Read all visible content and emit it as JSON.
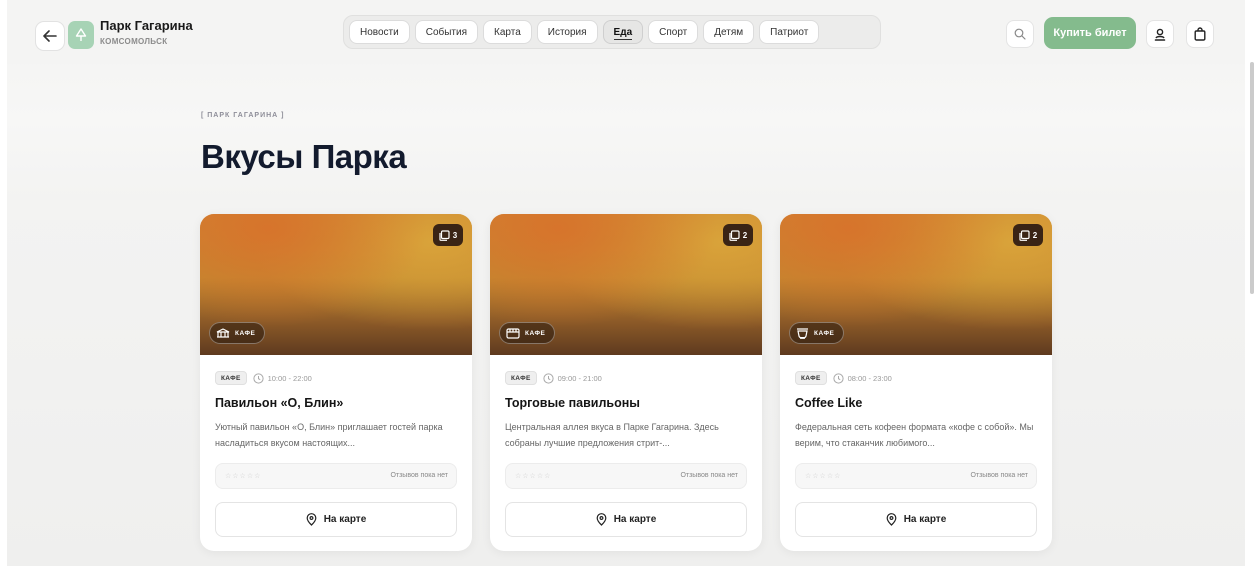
{
  "header": {
    "brand_title": "Парк Гагарина",
    "brand_subtitle": "КОМСОМОЛЬСК",
    "nav_tabs": [
      {
        "label": "Новости",
        "active": false
      },
      {
        "label": "События",
        "active": false
      },
      {
        "label": "Карта",
        "active": false
      },
      {
        "label": "История",
        "active": false
      },
      {
        "label": "Еда",
        "active": true
      },
      {
        "label": "Спорт",
        "active": false
      },
      {
        "label": "Детям",
        "active": false
      },
      {
        "label": "Патриот",
        "active": false
      }
    ],
    "buy_ticket_label": "Купить билет",
    "icons": [
      "arrow-left-icon",
      "tree-icon",
      "search-icon",
      "user-icon",
      "shopping-bag-icon"
    ]
  },
  "hero": {
    "breadcrumb": "[ ПАРК ГАГАРИНА ]",
    "title": "Вкусы Парка"
  },
  "cards": [
    {
      "photo_count": "3",
      "image_badge": "КАФЕ",
      "badge_icon": "pavilion-icon",
      "category": "КАФЕ",
      "hours": "10:00 - 22:00",
      "name": "Павильон «О, Блин»",
      "description": "Уютный павильон «О, Блин» приглашает гостей парка насладиться вкусом настоящих...",
      "rating_stars": "☆☆☆☆☆",
      "reviews_text": "Отзывов пока нет",
      "map_label": "На карте"
    },
    {
      "photo_count": "2",
      "image_badge": "КАФЕ",
      "badge_icon": "store-icon",
      "category": "КАФЕ",
      "hours": "09:00 - 21:00",
      "name": "Торговые павильоны",
      "description": "Центральная аллея вкуса в Парке Гагарина. Здесь собраны лучшие предложения стрит-...",
      "rating_stars": "☆☆☆☆☆",
      "reviews_text": "Отзывов пока нет",
      "map_label": "На карте"
    },
    {
      "photo_count": "2",
      "image_badge": "КАФЕ",
      "badge_icon": "coffee-cup-icon",
      "category": "КАФЕ",
      "hours": "08:00 - 23:00",
      "name": "Coffee Like",
      "description": "Федеральная сеть кофеен формата «кофе с собой». Мы верим, что стаканчик любимого...",
      "rating_stars": "☆☆☆☆☆",
      "reviews_text": "Отзывов пока нет",
      "map_label": "На карте"
    }
  ],
  "colors": {
    "accent_green": "#84bb8d",
    "logo_green": "#a7d3b5",
    "title_navy": "#131b2e"
  }
}
